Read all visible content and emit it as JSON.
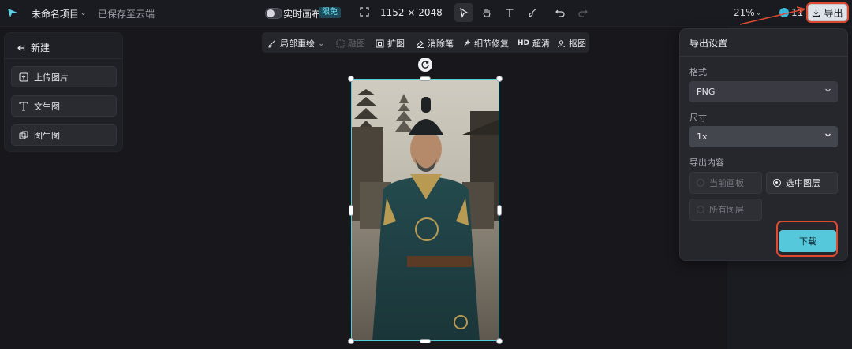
{
  "topbar": {
    "logo_icon": "jimeng-logo-icon",
    "project_title": "未命名项目",
    "project_caret": "⌄",
    "saved_status": "已保存至云端",
    "realtime_label": "实时画布",
    "limited_badge": "限免",
    "dimensions": "1152 × 2048",
    "zoom": "21%",
    "zoom_caret": "⌄",
    "credits": "11",
    "export_label": "导出"
  },
  "left_panel": {
    "new_label": "新建",
    "buttons": [
      {
        "label": "上传图片",
        "icon": "upload-image-icon"
      },
      {
        "label": "文生图",
        "icon": "text-to-image-icon"
      },
      {
        "label": "图生图",
        "icon": "image-to-image-icon"
      }
    ]
  },
  "float_toolbar": {
    "items": [
      {
        "label": "局部重绘",
        "icon": "inpaint-icon",
        "enabled": true
      },
      {
        "label": "融图",
        "icon": "blend-icon",
        "enabled": false
      },
      {
        "label": "扩图",
        "icon": "expand-icon",
        "enabled": true
      },
      {
        "label": "消除笔",
        "icon": "eraser-icon",
        "enabled": true
      },
      {
        "label": "细节修复",
        "icon": "detail-repair-icon",
        "enabled": true
      },
      {
        "label": "超清",
        "prefix": "HD",
        "enabled": true
      },
      {
        "label": "抠图",
        "icon": "cutout-icon",
        "enabled": true
      }
    ]
  },
  "export_panel": {
    "title": "导出设置",
    "format_label": "格式",
    "format_value": "PNG",
    "size_label": "尺寸",
    "size_value": "1x",
    "content_label": "导出内容",
    "options": [
      {
        "label": "当前画板",
        "selected": false,
        "enabled": false
      },
      {
        "label": "选中图层",
        "selected": true,
        "enabled": true
      },
      {
        "label": "所有图层",
        "selected": false,
        "enabled": false
      }
    ],
    "download_label": "下载"
  },
  "colors": {
    "accent": "#56c8dc",
    "selection": "#4fd0d8",
    "annotation": "#e04a30"
  }
}
